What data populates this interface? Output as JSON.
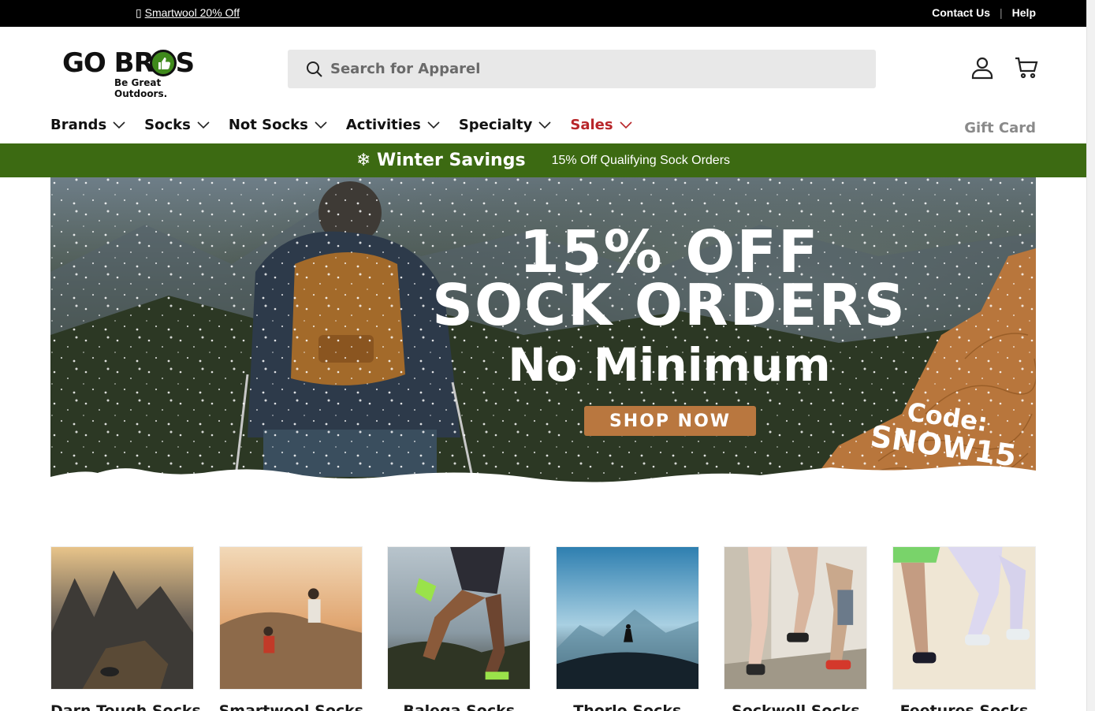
{
  "announcement": {
    "promo_icon": "tag-icon",
    "promo_text": "Smartwool 20% Off",
    "contact": "Contact Us",
    "separator": "|",
    "help": "Help"
  },
  "header": {
    "logo_word": "GOBR S",
    "logo_tagline": "Be Great Outdoors.",
    "search_placeholder": "Search for Apparel",
    "account_icon": "user-icon",
    "cart_icon": "cart-icon"
  },
  "nav": {
    "items": [
      {
        "label": "Brands"
      },
      {
        "label": "Socks"
      },
      {
        "label": "Not Socks"
      },
      {
        "label": "Activities"
      },
      {
        "label": "Specialty"
      },
      {
        "label": "Sales"
      }
    ],
    "gift_card": "Gift Card"
  },
  "savings_bar": {
    "title": "❄ Winter Savings",
    "subtitle": "15% Off Qualifying Sock Orders",
    "color": "#3c6a12"
  },
  "hero": {
    "line1": "15% OFF",
    "line2": "SOCK ORDERS",
    "line3": "No Minimum",
    "cta": "SHOP NOW",
    "code_label": "Code:",
    "code_value": "SNOW15",
    "accent": "#b9773f"
  },
  "categories": [
    {
      "label": "Darn Tough Socks"
    },
    {
      "label": "Smartwool Socks"
    },
    {
      "label": "Balega Socks"
    },
    {
      "label": "Thorlo Socks"
    },
    {
      "label": "Sockwell Socks"
    },
    {
      "label": "Feetures Socks"
    }
  ]
}
